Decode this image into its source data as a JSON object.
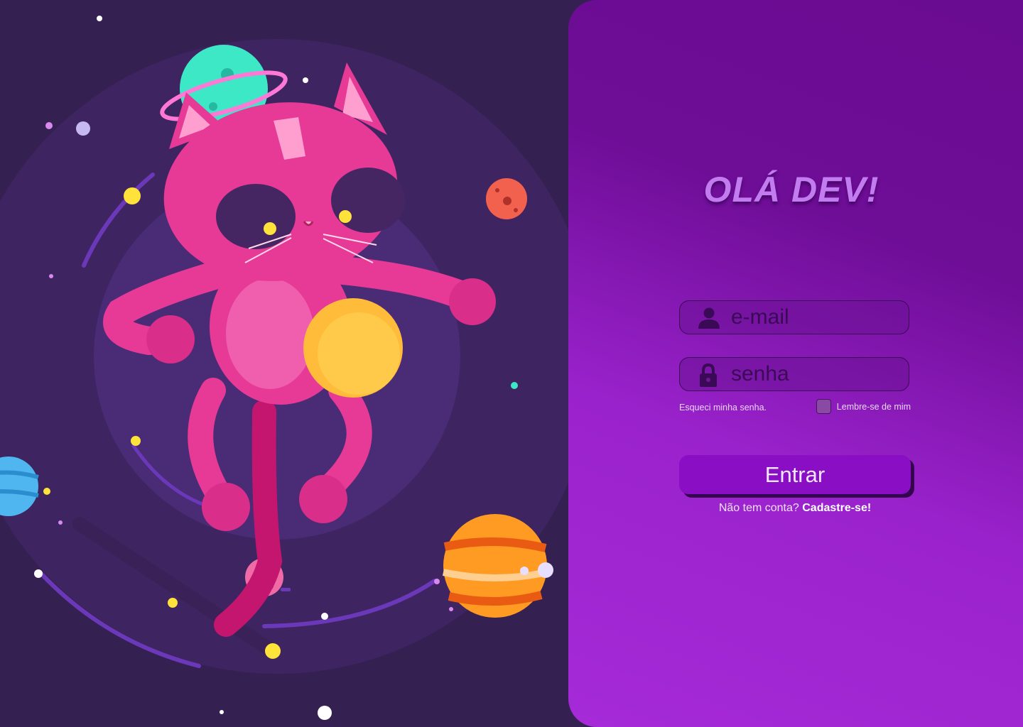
{
  "login": {
    "title": "OLÁ DEV!",
    "email_placeholder": "e-mail",
    "password_placeholder": "senha",
    "forgot_password": "Esqueci minha senha.",
    "remember_me": "Lembre-se de mim",
    "submit_label": "Entrar",
    "signup_prompt": "Não tem conta?",
    "signup_link": "Cadastre-se!"
  },
  "icons": {
    "email": "user-icon",
    "password": "lock-icon"
  },
  "colors": {
    "background": "#352052",
    "panel_top": "#6a0c92",
    "panel_bottom": "#a62ad8",
    "title": "#c27cf0",
    "button": "#8a0fc4",
    "cat": "#e63a96"
  }
}
